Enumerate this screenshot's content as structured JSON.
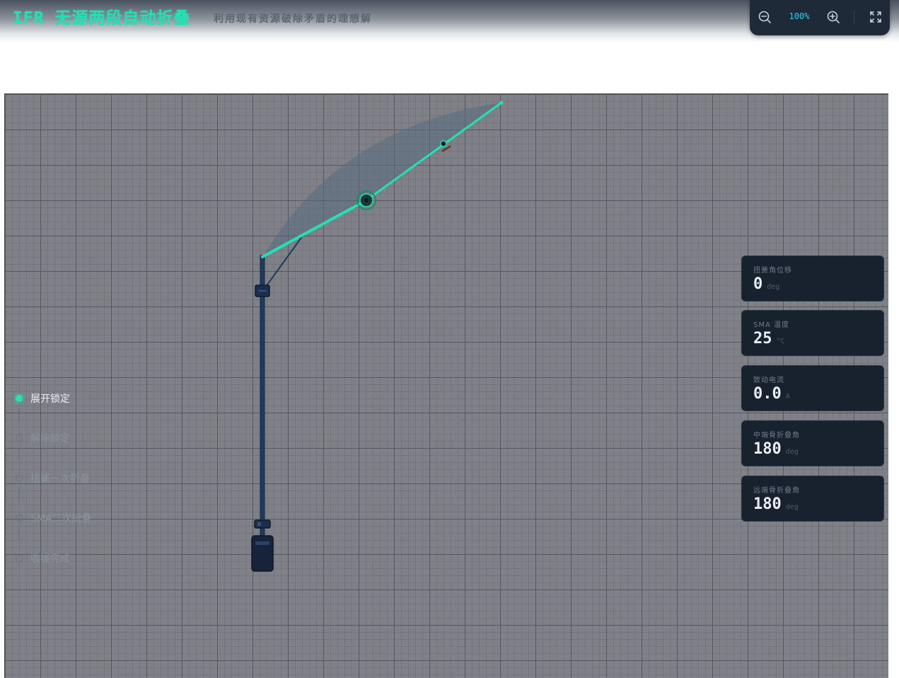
{
  "header": {
    "title": "IFR 无源两段自动折叠",
    "subtitle": "利用现有资源破除矛盾的理想解"
  },
  "zoom": {
    "level": "100%",
    "zoom_out_icon": "zoom-out-icon",
    "zoom_in_icon": "zoom-in-icon",
    "fullscreen_icon": "fullscreen-icon"
  },
  "steps": [
    {
      "label": "展开锁定",
      "active": true
    },
    {
      "label": "解除锁定",
      "active": false
    },
    {
      "label": "扭簧一次折叠",
      "active": false
    },
    {
      "label": "SMA二次折叠",
      "active": false
    },
    {
      "label": "收拢完成",
      "active": false
    }
  ],
  "metrics": [
    {
      "label": "扭簧角位移",
      "value": "0",
      "unit": "deg"
    },
    {
      "label": "SMA 温度",
      "value": "25",
      "unit": "°C"
    },
    {
      "label": "致动电流",
      "value": "0.0",
      "unit": "A"
    },
    {
      "label": "中端骨折叠角",
      "value": "180",
      "unit": "deg"
    },
    {
      "label": "远端骨折叠角",
      "value": "180",
      "unit": "deg"
    }
  ],
  "colors": {
    "accent": "#1fe3b5",
    "panel": "#18212e",
    "mast": "#1e3a5f",
    "zoom_text": "#22d3ee"
  }
}
